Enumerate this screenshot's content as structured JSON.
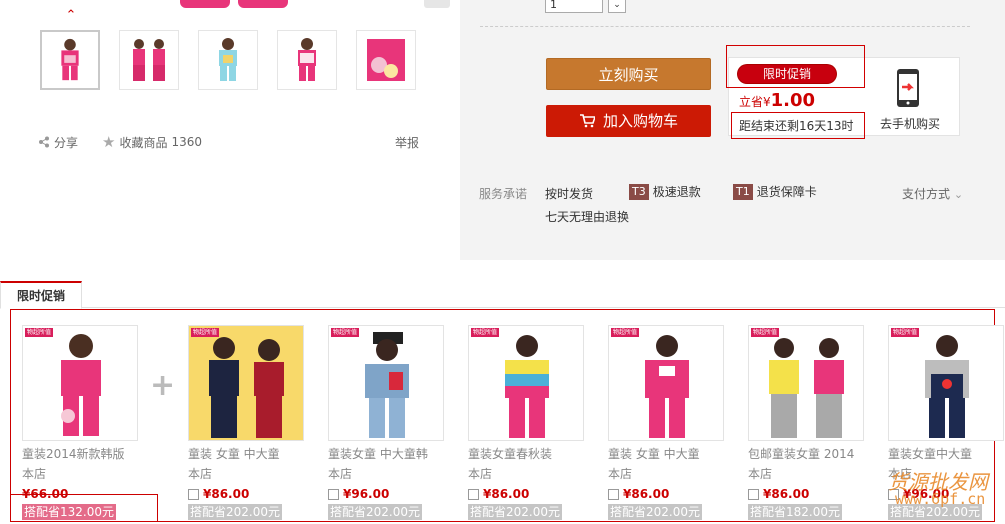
{
  "gallery": {
    "thumbs": [
      "thumb-1",
      "thumb-2",
      "thumb-3",
      "thumb-4",
      "thumb-5"
    ],
    "share_label": "分享",
    "favorite_label": "收藏商品",
    "favorite_count": "1360",
    "report_label": "举报"
  },
  "purchase": {
    "quantity": "1",
    "buy_now_label": "立刻购买",
    "add_cart_label": "加入购物车"
  },
  "promo": {
    "badge": "限时促销",
    "save_prefix": "立省¥",
    "save_amount": "1.00",
    "countdown": "距结束还剩16天13时",
    "mobile_label": "去手机购买"
  },
  "service": {
    "title": "服务承诺",
    "items": [
      {
        "tag": "",
        "label": "按时发货"
      },
      {
        "tag": "T3",
        "label": "极速退款"
      },
      {
        "tag": "T1",
        "label": "退货保障卡"
      },
      {
        "tag": "",
        "label": "七天无理由退换"
      }
    ],
    "payment_label": "支付方式"
  },
  "tab": {
    "label": "限时促销"
  },
  "products": [
    {
      "title": "童装2014新款韩版",
      "shop": "本店",
      "price": "¥66.00",
      "saved": "搭配省132.00元",
      "ribbon": "物超所值"
    },
    {
      "title": "童装 女童 中大童",
      "shop": "本店",
      "price": "¥86.00",
      "saved": "搭配省202.00元",
      "ribbon": "物超所值"
    },
    {
      "title": "童装女童 中大童韩",
      "shop": "本店",
      "price": "¥96.00",
      "saved": "搭配省202.00元",
      "ribbon": "物超所值"
    },
    {
      "title": "童装女童春秋装",
      "shop": "本店",
      "price": "¥86.00",
      "saved": "搭配省202.00元",
      "ribbon": "物超所值"
    },
    {
      "title": "童装 女童 中大童",
      "shop": "本店",
      "price": "¥86.00",
      "saved": "搭配省202.00元",
      "ribbon": "物超所值"
    },
    {
      "title": "包邮童装女童 2014",
      "shop": "本店",
      "price": "¥86.00",
      "saved": "搭配省182.00元",
      "ribbon": "物超所值"
    },
    {
      "title": "童装女童中大童",
      "shop": "本店",
      "price": "¥96.00",
      "saved": "搭配省202.00元",
      "ribbon": "物超所值"
    }
  ],
  "watermark": {
    "line1": "货源批发网",
    "line2": "www.6pf.cn"
  },
  "colors": {
    "accent": "#cc1a05",
    "buy": "#c6782e",
    "promo": "#c8000e"
  }
}
